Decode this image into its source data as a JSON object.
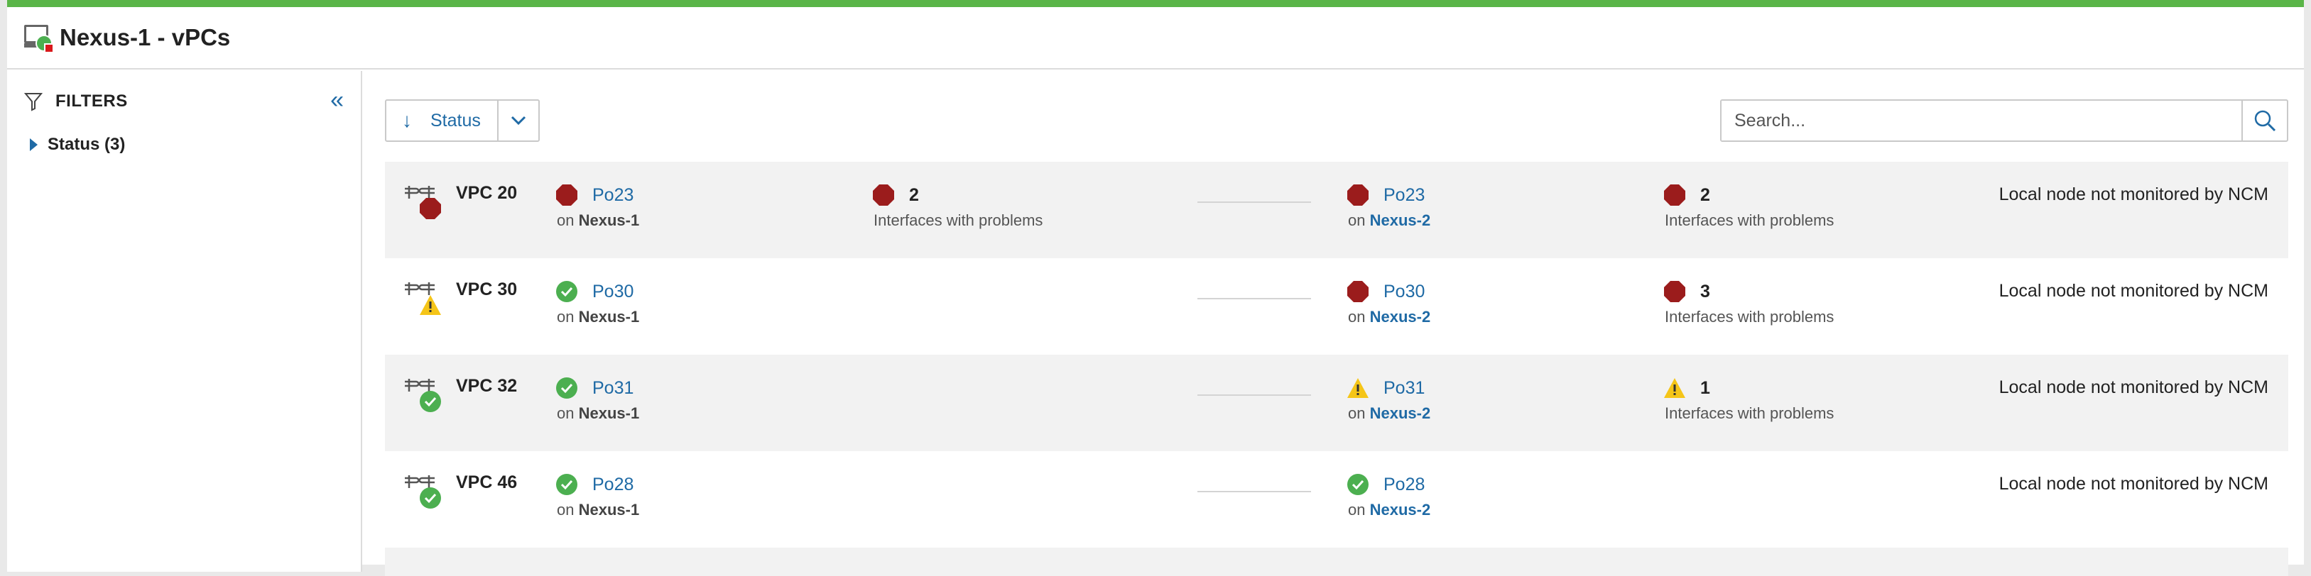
{
  "header": {
    "title": "Nexus-1 - vPCs"
  },
  "filters": {
    "heading": "FILTERS",
    "collapse_icon": "double-chevron-left-icon",
    "groups": [
      {
        "label": "Status (3)"
      }
    ]
  },
  "toolbar": {
    "sort_label": "Status",
    "sort_icon": "arrow-down-icon",
    "dropdown_icon": "chevron-down-icon",
    "search_placeholder": "Search..."
  },
  "colors": {
    "accent": "#5ab548",
    "link": "#1f6aa5",
    "critical": "#9b1c1c",
    "ok": "#4caf50",
    "warning": "#f5c518"
  },
  "rows": [
    {
      "name": "VPC 20",
      "status": "critical",
      "local": {
        "status": "critical",
        "port": "Po23",
        "on_prefix": "on",
        "node": "Nexus-1"
      },
      "local_problems": {
        "status": "critical",
        "count": "2",
        "label": "Interfaces with problems"
      },
      "remote": {
        "status": "critical",
        "port": "Po23",
        "on_prefix": "on",
        "node": "Nexus-2"
      },
      "remote_problems": {
        "status": "critical",
        "count": "2",
        "label": "Interfaces with problems"
      },
      "note": "Local node not monitored by NCM"
    },
    {
      "name": "VPC 30",
      "status": "warning",
      "local": {
        "status": "ok",
        "port": "Po30",
        "on_prefix": "on",
        "node": "Nexus-1"
      },
      "local_problems": null,
      "remote": {
        "status": "critical",
        "port": "Po30",
        "on_prefix": "on",
        "node": "Nexus-2"
      },
      "remote_problems": {
        "status": "critical",
        "count": "3",
        "label": "Interfaces with problems"
      },
      "note": "Local node not monitored by NCM"
    },
    {
      "name": "VPC 32",
      "status": "ok",
      "local": {
        "status": "ok",
        "port": "Po31",
        "on_prefix": "on",
        "node": "Nexus-1"
      },
      "local_problems": null,
      "remote": {
        "status": "warning",
        "port": "Po31",
        "on_prefix": "on",
        "node": "Nexus-2"
      },
      "remote_problems": {
        "status": "warning",
        "count": "1",
        "label": "Interfaces with problems"
      },
      "note": "Local node not monitored by NCM"
    },
    {
      "name": "VPC 46",
      "status": "ok",
      "local": {
        "status": "ok",
        "port": "Po28",
        "on_prefix": "on",
        "node": "Nexus-1"
      },
      "local_problems": null,
      "remote": {
        "status": "ok",
        "port": "Po28",
        "on_prefix": "on",
        "node": "Nexus-2"
      },
      "remote_problems": null,
      "note": "Local node not monitored by NCM"
    }
  ]
}
